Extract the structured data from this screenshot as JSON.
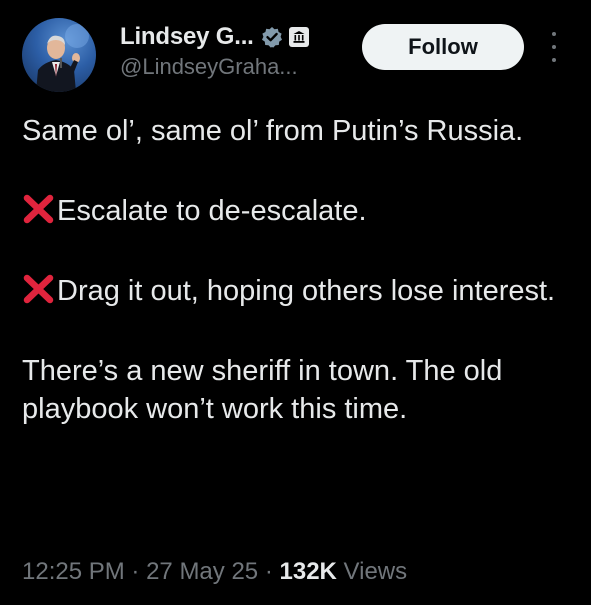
{
  "author": {
    "display_name": "Lindsey G...",
    "handle": "@LindseyGraha...",
    "verified_icon": "verified-badge-icon",
    "affiliate_icon": "government-building-icon"
  },
  "actions": {
    "follow_label": "Follow",
    "more_icon": "more-vertical-icon"
  },
  "tweet": {
    "line1": "Same ol’, same ol’ from Putin’s Russia.",
    "item1": "Escalate to de-escalate.",
    "item2": "Drag it out, hoping  others lose interest.",
    "closing": "There’s a new sheriff in town. The old playbook won’t work this time."
  },
  "meta": {
    "time": "12:25 PM",
    "date": "27 May 25",
    "views_count": "132K",
    "views_label": "Views",
    "separator": "·"
  },
  "colors": {
    "background": "#000000",
    "text": "#e7e9ea",
    "secondary": "#71767b",
    "verified": "#829aab",
    "cross": "#e0243d"
  }
}
